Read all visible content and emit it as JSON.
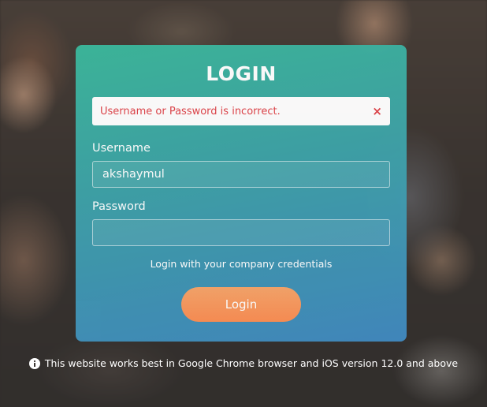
{
  "login": {
    "title": "LOGIN",
    "error_message": "Username or Password is incorrect.",
    "close_glyph": "×",
    "username_label": "Username",
    "username_value": "akshaymul",
    "password_label": "Password",
    "password_value": "",
    "hint": "Login with your company credentials",
    "button_label": "Login"
  },
  "footer": {
    "icon": "info-icon",
    "text": "This website works best in Google Chrome browser and iOS version 12.0 and above"
  },
  "colors": {
    "card_gradient_start": "#3bb79b",
    "card_gradient_end": "#4188bf",
    "error_text": "#e0444a",
    "button": "#fb8e54"
  }
}
